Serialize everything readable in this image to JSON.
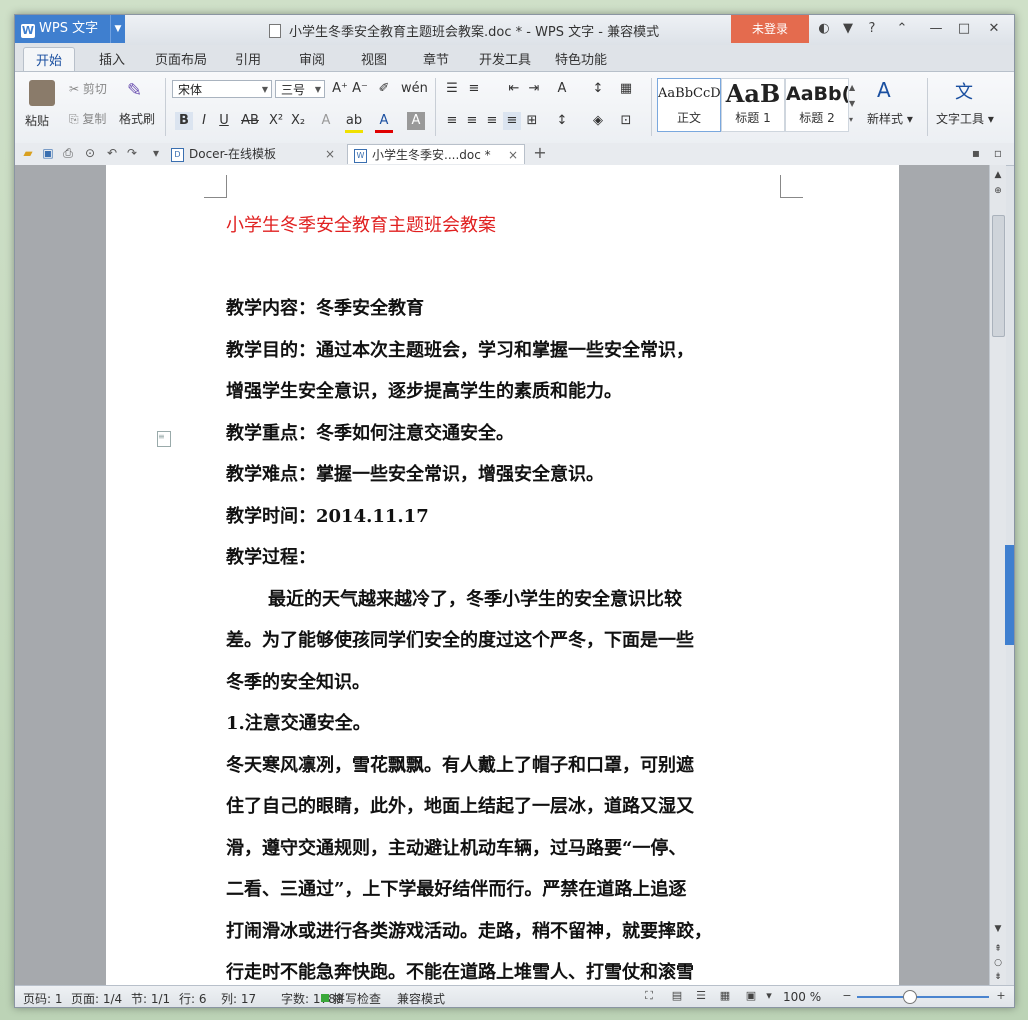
{
  "app": {
    "name": "WPS 文字",
    "title": "小学生冬季安全教育主题班会教案.doc * - WPS 文字 - 兼容模式",
    "login": "未登录"
  },
  "tabs": [
    "开始",
    "插入",
    "页面布局",
    "引用",
    "审阅",
    "视图",
    "章节",
    "开发工具",
    "特色功能"
  ],
  "ribbon": {
    "paste": "粘贴",
    "cut": "剪切",
    "copy": "复制",
    "format_painter": "格式刷",
    "font": "宋体",
    "size": "三号",
    "styles": [
      {
        "preview": "AaBbCcD",
        "name": "正文"
      },
      {
        "preview": "AaB",
        "name": "标题 1"
      },
      {
        "preview": "AaBb(",
        "name": "标题 2"
      }
    ],
    "new_style": "新样式",
    "text_tools": "文字工具"
  },
  "doc_tabs": [
    {
      "label": "Docer-在线模板",
      "close": "×"
    },
    {
      "label": "小学生冬季安....doc *",
      "close": "×"
    }
  ],
  "document": {
    "title": "小学生冬季安全教育主题班会教案",
    "lines": [
      "",
      "教学内容：冬季安全教育",
      "教学目的：通过本次主题班会，学习和掌握一些安全常识，",
      "增强学生安全意识，逐步提高学生的素质和能力。",
      "教学重点：冬季如何注意交通安全。",
      "教学难点：掌握一些安全常识，增强安全意识。",
      "教学时间：2014.11.17",
      "教学过程：",
      "最近的天气越来越冷了，冬季小学生的安全意识比较",
      "差。为了能够使孩同学们安全的度过这个严冬，下面是一些",
      "冬季的安全知识。",
      "1.注意交通安全。",
      "冬天寒风凛冽，雪花飘飘。有人戴上了帽子和口罩，可别遮",
      "住了自己的眼睛，此外，地面上结起了一层冰，道路又湿又",
      "滑，遵守交通规则，主动避让机动车辆，过马路要“一停、",
      "二看、三通过”，上下学最好结伴而行。严禁在道路上追逐",
      "打闹滑冰或进行各类游戏活动。走路，稍不留神，就要摔跤，",
      "行走时不能急奔快跑。不能在道路上堆雪人、打雪仗和滚雪"
    ]
  },
  "status": {
    "page_num": "页码: 1",
    "page": "页面: 1/4",
    "section": "节: 1/1",
    "row": "行: 6",
    "col": "列: 17",
    "words": "字数: 1788",
    "spell": "拼写检查",
    "mode": "兼容模式",
    "zoom": "100 %"
  },
  "colors": {
    "accent": "#3f7fcf",
    "login": "#e46b4e",
    "title_red": "#e02020"
  }
}
